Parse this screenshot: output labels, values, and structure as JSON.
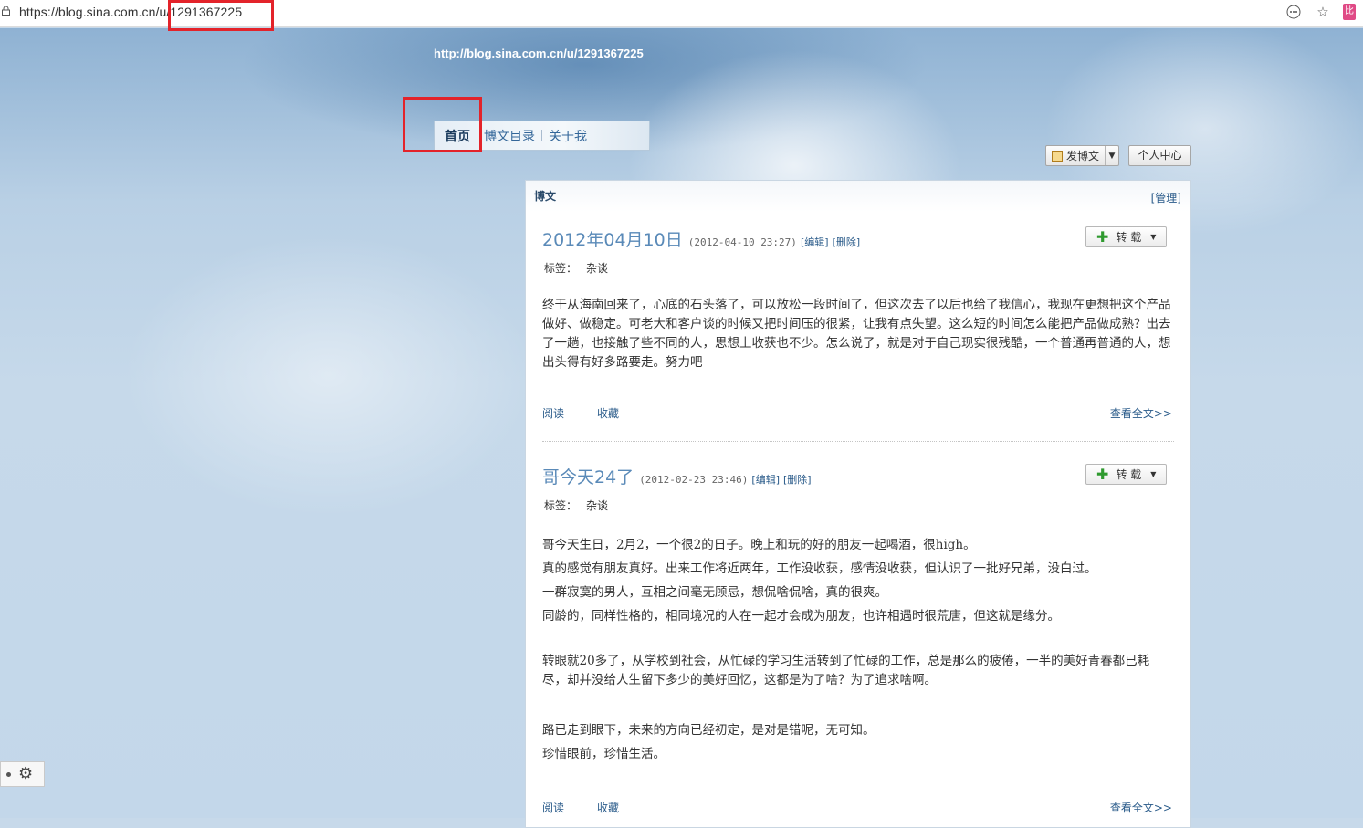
{
  "browser": {
    "url_prefix": "https://blog.sina.com.cn/u/",
    "url_path": "1291367225",
    "ext_label": "比"
  },
  "header": {
    "blog_url": "http://blog.sina.com.cn/u/1291367225"
  },
  "nav": {
    "items": [
      {
        "label": "首页"
      },
      {
        "label": "博文目录"
      },
      {
        "label": "关于我"
      }
    ]
  },
  "toolbar": {
    "post_label": "发博文",
    "center_label": "个人中心"
  },
  "panel": {
    "title": "博文",
    "manage": "[管理]"
  },
  "posts": [
    {
      "title": "2012年04月10日",
      "date": "(2012-04-10 23:27)",
      "edit": "[编辑]",
      "delete": "[删除]",
      "repost": "转 载",
      "tags_label": "标签：",
      "tag": "杂谈",
      "paragraphs": [
        "终于从海南回来了，心底的石头落了，可以放松一段时间了，但这次去了以后也给了我信心，我现在更想把这个产品做好、做稳定。可老大和客户谈的时候又把时间压的很紧，让我有点失望。这么短的时间怎么能把产品做成熟？出去了一趟，也接触了些不同的人，思想上收获也不少。怎么说了，就是对于自己现实很残酷，一个普通再普通的人，想出头得有好多路要走。努力吧"
      ],
      "read": "阅读",
      "fav": "收藏",
      "more": "查看全文>>"
    },
    {
      "title": "哥今天24了",
      "date": "(2012-02-23 23:46)",
      "edit": "[编辑]",
      "delete": "[删除]",
      "repost": "转 载",
      "tags_label": "标签：",
      "tag": "杂谈",
      "paragraphs": [
        "哥今天生日，2月2，一个很2的日子。晚上和玩的好的朋友一起喝酒，很high。",
        "真的感觉有朋友真好。出来工作将近两年，工作没收获，感情没收获，但认识了一批好兄弟，没白过。",
        "一群寂寞的男人，互相之间毫无顾忌，想侃啥侃啥，真的很爽。",
        "同龄的，同样性格的，相同境况的人在一起才会成为朋友，也许相遇时很荒唐，但这就是缘分。",
        "转眼就20多了，从学校到社会，从忙碌的学习生活转到了忙碌的工作，总是那么的疲倦，一半的美好青春都已耗尽，却并没给人生留下多少的美好回忆，这都是为了啥？为了追求啥啊。",
        "路已走到眼下，未来的方向已经初定，是对是错呢，无可知。",
        "珍惜眼前，珍惜生活。"
      ],
      "read": "阅读",
      "fav": "收藏",
      "more": "查看全文>>"
    }
  ]
}
